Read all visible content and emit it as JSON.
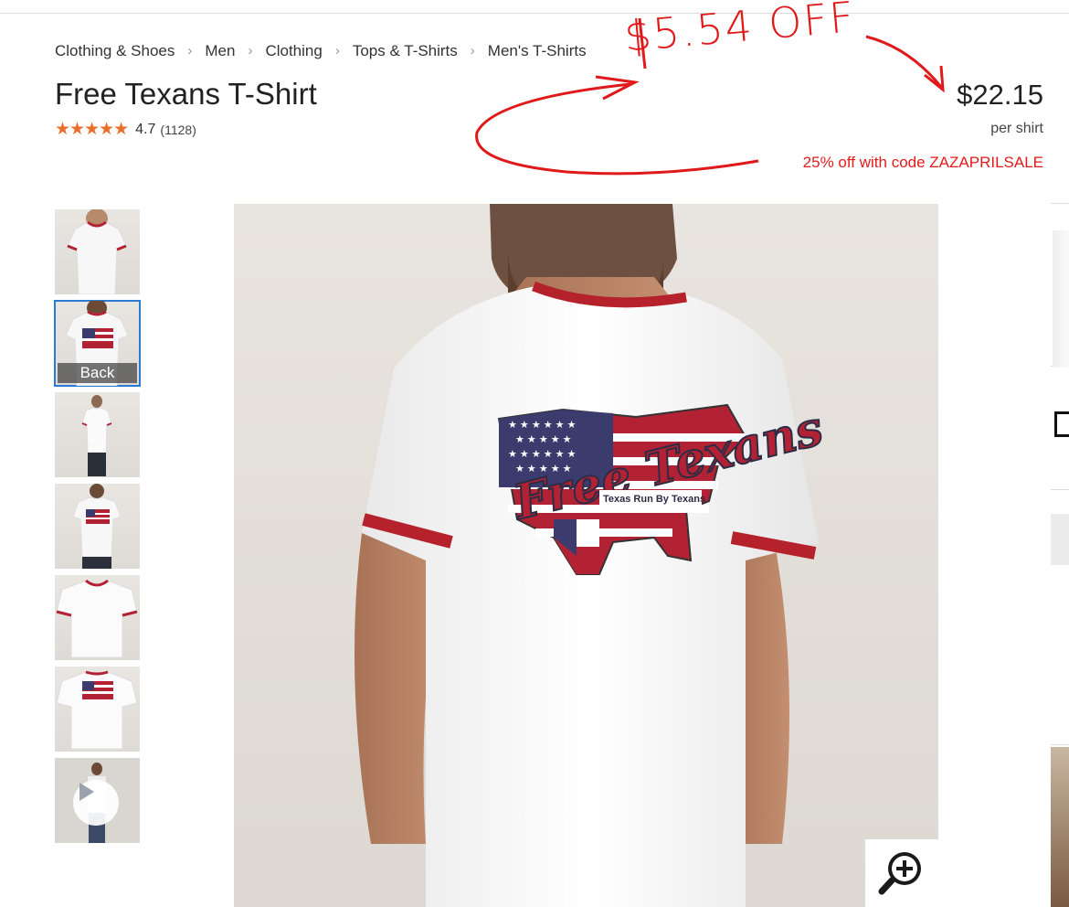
{
  "breadcrumb": [
    {
      "label": "Clothing & Shoes"
    },
    {
      "label": "Men"
    },
    {
      "label": "Clothing"
    },
    {
      "label": "Tops & T-Shirts"
    },
    {
      "label": "Men's T-Shirts"
    }
  ],
  "product": {
    "title": "Free Texans T-Shirt",
    "stars": "★★★★★",
    "rating": "4.7",
    "review_count": "(1128)",
    "price": "$22.15",
    "unit": "per shirt",
    "promo": "25% off with code ZAZAPRILSALE"
  },
  "gallery": {
    "thumbnails": [
      {
        "view": "front",
        "label": ""
      },
      {
        "view": "back",
        "label": "Back",
        "selected": true
      },
      {
        "view": "model-front",
        "label": ""
      },
      {
        "view": "model-back",
        "label": ""
      },
      {
        "view": "flat-front",
        "label": ""
      },
      {
        "view": "flat-back",
        "label": ""
      },
      {
        "view": "video",
        "label": ""
      }
    ]
  },
  "main_image": {
    "print_text_1": "Free Texans",
    "print_text_2": "Texas Run By Texans"
  },
  "annotation": {
    "handwritten": "$5.54 OFF"
  },
  "colors": {
    "accent_orange": "#e8702a",
    "promo_red": "#e21b1b",
    "selection_blue": "#2a7bd1",
    "annotation_red": "#e01a1a"
  }
}
